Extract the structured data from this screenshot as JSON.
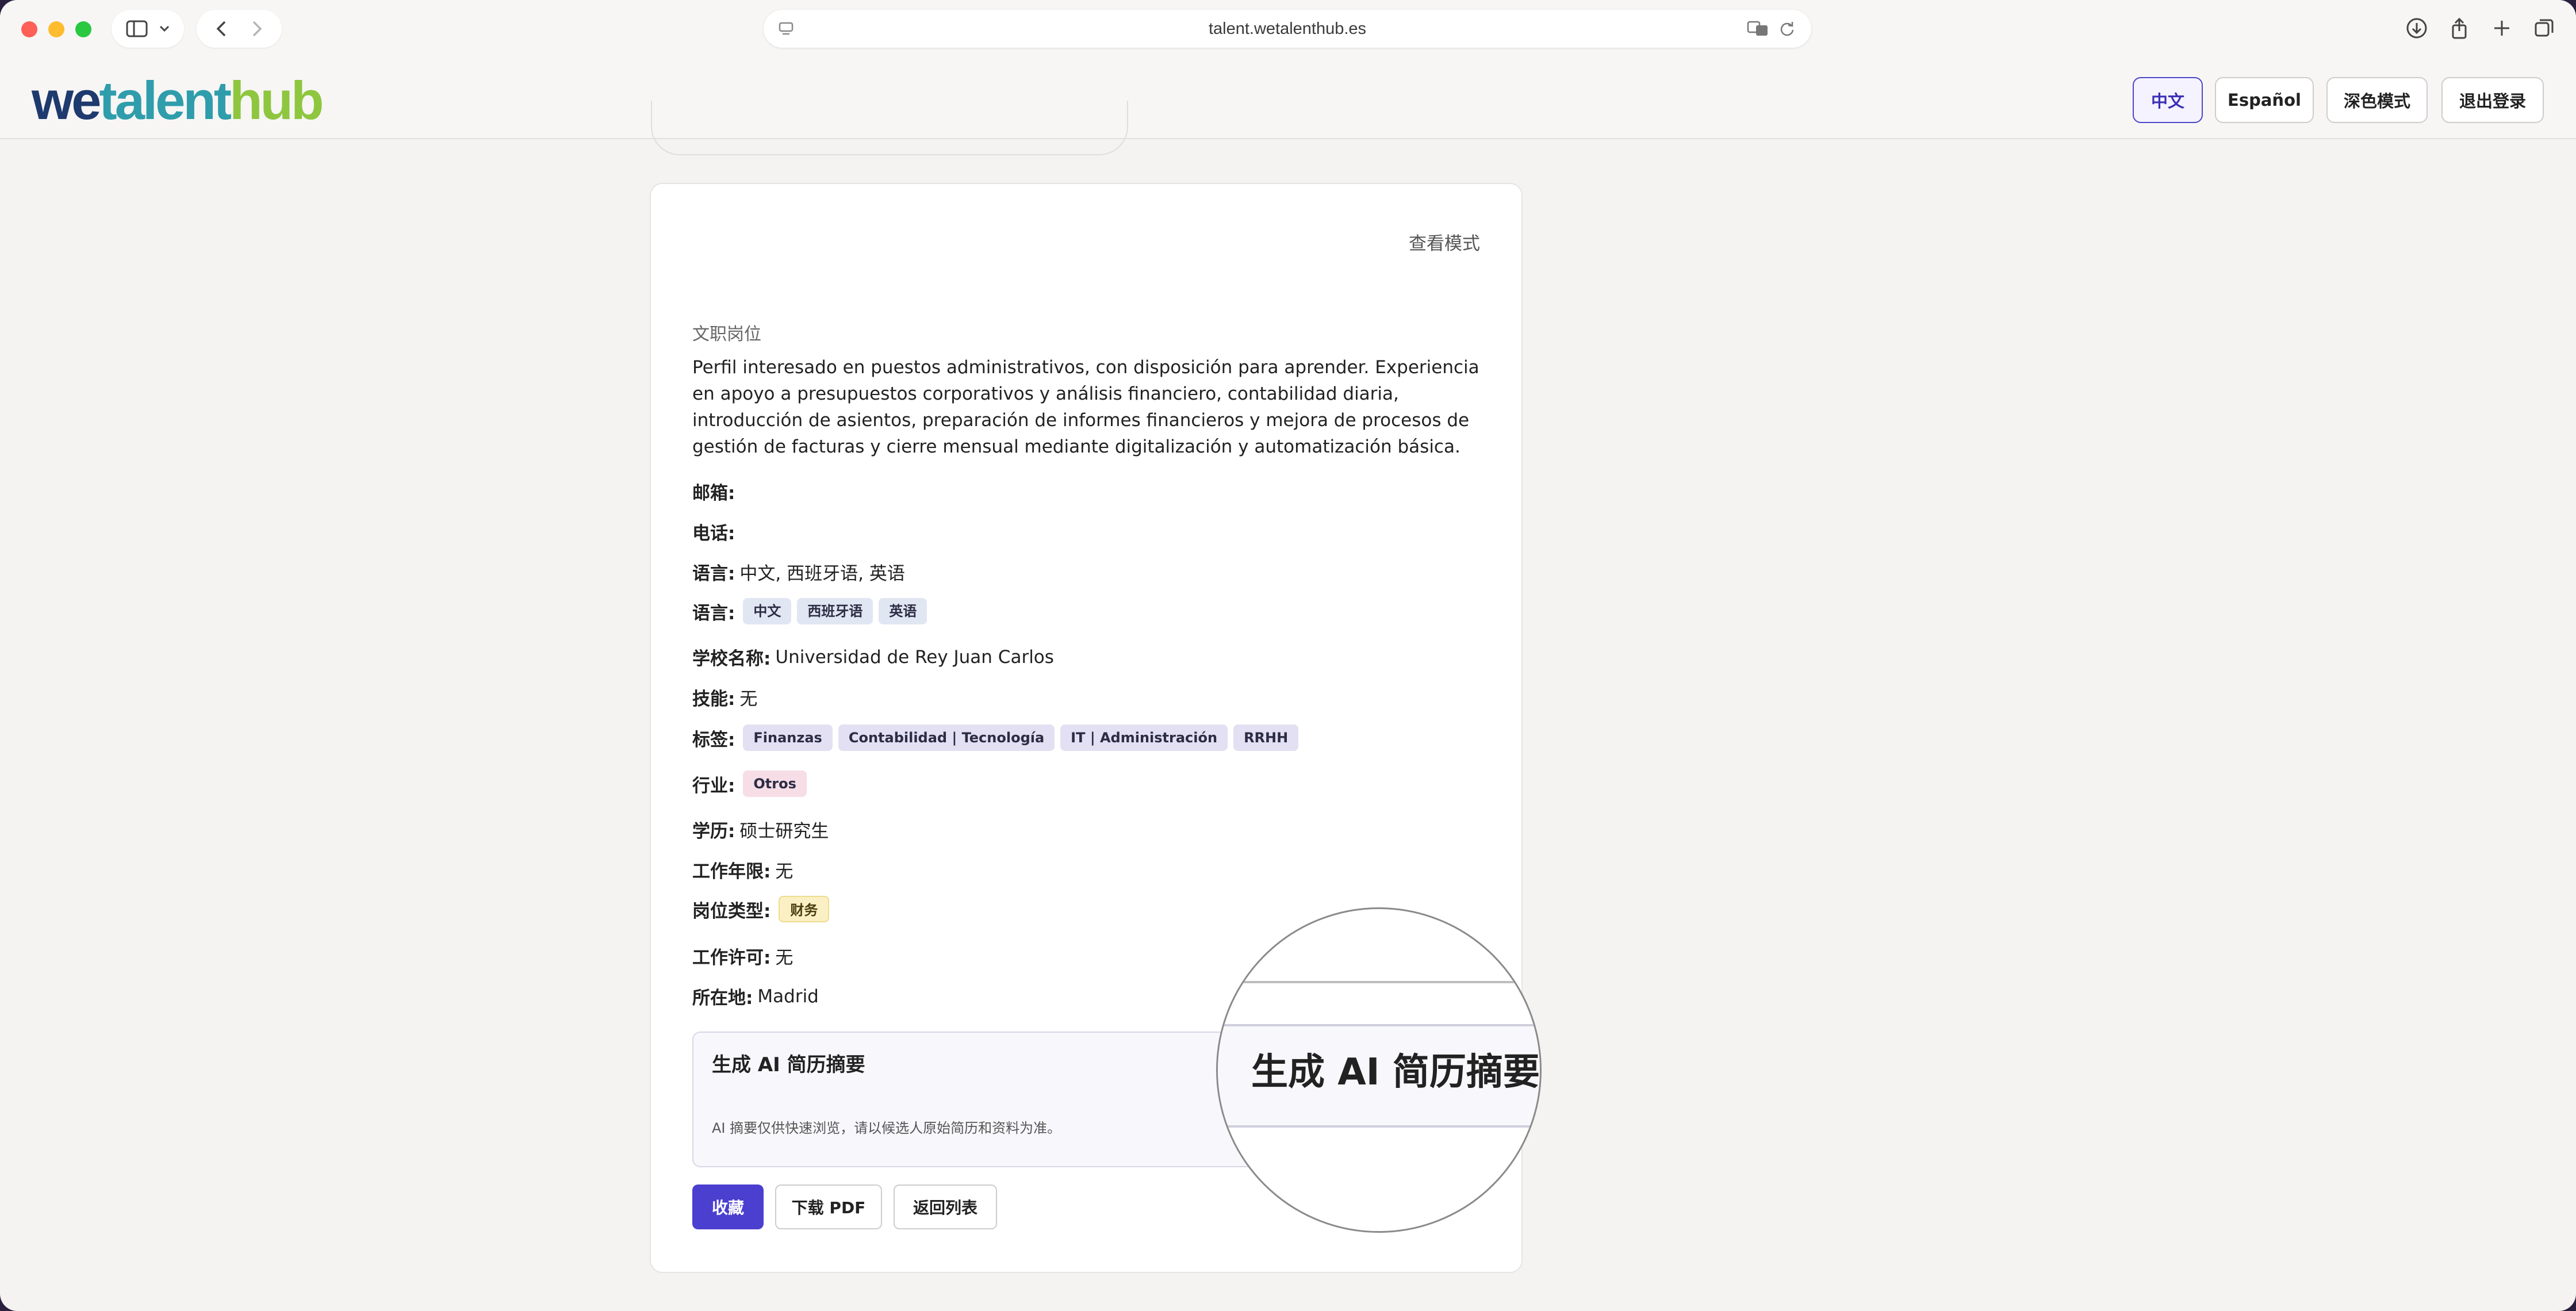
{
  "browser": {
    "url": "talent.wetalenthub.es"
  },
  "header": {
    "logo": {
      "we": "we",
      "talent": "talent",
      "hub": "hub"
    },
    "buttons": {
      "chinese": "中文",
      "spanish": "Español",
      "dark_mode": "深色模式",
      "logout": "退出登录"
    }
  },
  "profile": {
    "view_mode": "查看模式",
    "job_title": "文职岗位",
    "summary": "Perfil interesado en puestos administrativos, con disposición para aprender. Experiencia en apoyo a presupuestos corporativos y análisis financiero, contabilidad diaria, introducción de asientos, preparación de informes financieros y mejora de procesos de gestión de facturas y cierre mensual mediante digitalización y automatización básica.",
    "fields": {
      "email_label": "邮箱:",
      "email_value": "",
      "phone_label": "电话:",
      "phone_value": "",
      "languages_label": "语言:",
      "languages_value": "中文, 西班牙语, 英语",
      "languages_chips_label": "语言:",
      "languages_chips": [
        "中文",
        "西班牙语",
        "英语"
      ],
      "school_label": "学校名称:",
      "school_value": "Universidad de Rey Juan Carlos",
      "skills_label": "技能:",
      "skills_value": "无",
      "tags_label": "标签:",
      "tags": [
        "Finanzas",
        "Contabilidad | Tecnología",
        "IT | Administración",
        "RRHH"
      ],
      "industry_label": "行业:",
      "industry": [
        "Otros"
      ],
      "education_label": "学历:",
      "education_value": "硕士研究生",
      "experience_label": "工作年限:",
      "experience_value": "无",
      "position_type_label": "岗位类型:",
      "position_type": [
        "财务"
      ],
      "work_permit_label": "工作许可:",
      "work_permit_value": "无",
      "location_label": "所在地:",
      "location_value": "Madrid"
    },
    "ai_summary": {
      "title": "生成 AI 简历摘要",
      "note": "AI 摘要仅供快速浏览，请以候选人原始简历和资料为准。"
    },
    "actions": {
      "favorite": "收藏",
      "download_pdf": "下载 PDF",
      "back_to_list": "返回列表"
    }
  },
  "magnifier": {
    "text": "生成 AI 简历摘要"
  }
}
